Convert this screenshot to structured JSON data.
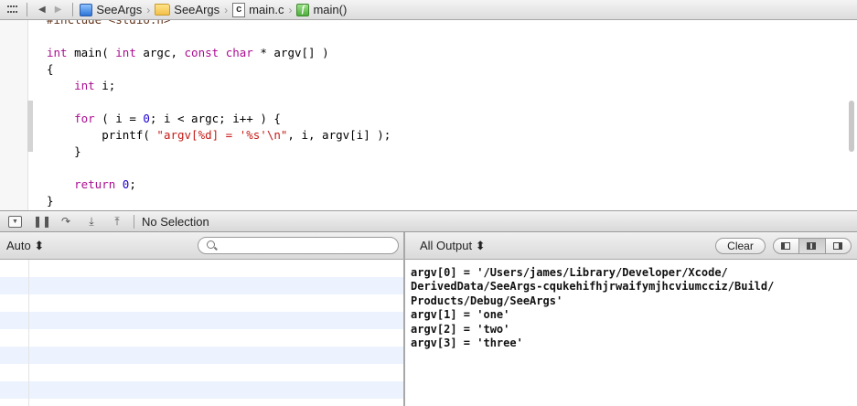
{
  "jumpbar": {
    "breadcrumbs": [
      {
        "label": "SeeArgs",
        "icon": "xcode-project-icon"
      },
      {
        "label": "SeeArgs",
        "icon": "folder-icon"
      },
      {
        "label": "main.c",
        "icon": "c-file-icon",
        "icon_glyph": "c"
      },
      {
        "label": "main()",
        "icon": "function-icon",
        "icon_glyph": "f"
      }
    ]
  },
  "editor": {
    "lines": [
      [
        {
          "t": "#include <stdio.h>",
          "c": "pp"
        }
      ],
      [],
      [
        {
          "t": "int",
          "c": "kw"
        },
        {
          "t": " main( "
        },
        {
          "t": "int",
          "c": "kw"
        },
        {
          "t": " argc, "
        },
        {
          "t": "const",
          "c": "kw"
        },
        {
          "t": " "
        },
        {
          "t": "char",
          "c": "kw"
        },
        {
          "t": " * argv[] )"
        }
      ],
      [
        {
          "t": "{"
        }
      ],
      [
        {
          "t": "    "
        },
        {
          "t": "int",
          "c": "kw"
        },
        {
          "t": " i;"
        }
      ],
      [],
      [
        {
          "t": "    "
        },
        {
          "t": "for",
          "c": "kw"
        },
        {
          "t": " ( i = "
        },
        {
          "t": "0",
          "c": "num"
        },
        {
          "t": "; i < argc; i++ ) {"
        }
      ],
      [
        {
          "t": "        printf( "
        },
        {
          "t": "\"argv[%d] = '%s'\\n\"",
          "c": "str"
        },
        {
          "t": ", i, argv[i] );"
        }
      ],
      [
        {
          "t": "    }"
        }
      ],
      [],
      [
        {
          "t": "    "
        },
        {
          "t": "return",
          "c": "kw"
        },
        {
          "t": " "
        },
        {
          "t": "0",
          "c": "num"
        },
        {
          "t": ";"
        }
      ],
      [
        {
          "t": "}"
        }
      ]
    ]
  },
  "debugbar": {
    "no_selection": "No Selection",
    "buttons": {
      "pause": "❚❚",
      "step_over": "↷",
      "step_into": "⤓",
      "step_out": "⤒",
      "hide": "▼"
    }
  },
  "variables": {
    "scope": "Auto ⬍",
    "search_placeholder": ""
  },
  "console": {
    "filter": "All Output ⬍",
    "clear": "Clear",
    "output": "argv[0] = '/Users/james/Library/Developer/Xcode/\nDerivedData/SeeArgs-cqukehifhjrwaifymjhcviumcciz/Build/\nProducts/Debug/SeeArgs'\nargv[1] = 'one'\nargv[2] = 'two'\nargv[3] = 'three'"
  }
}
